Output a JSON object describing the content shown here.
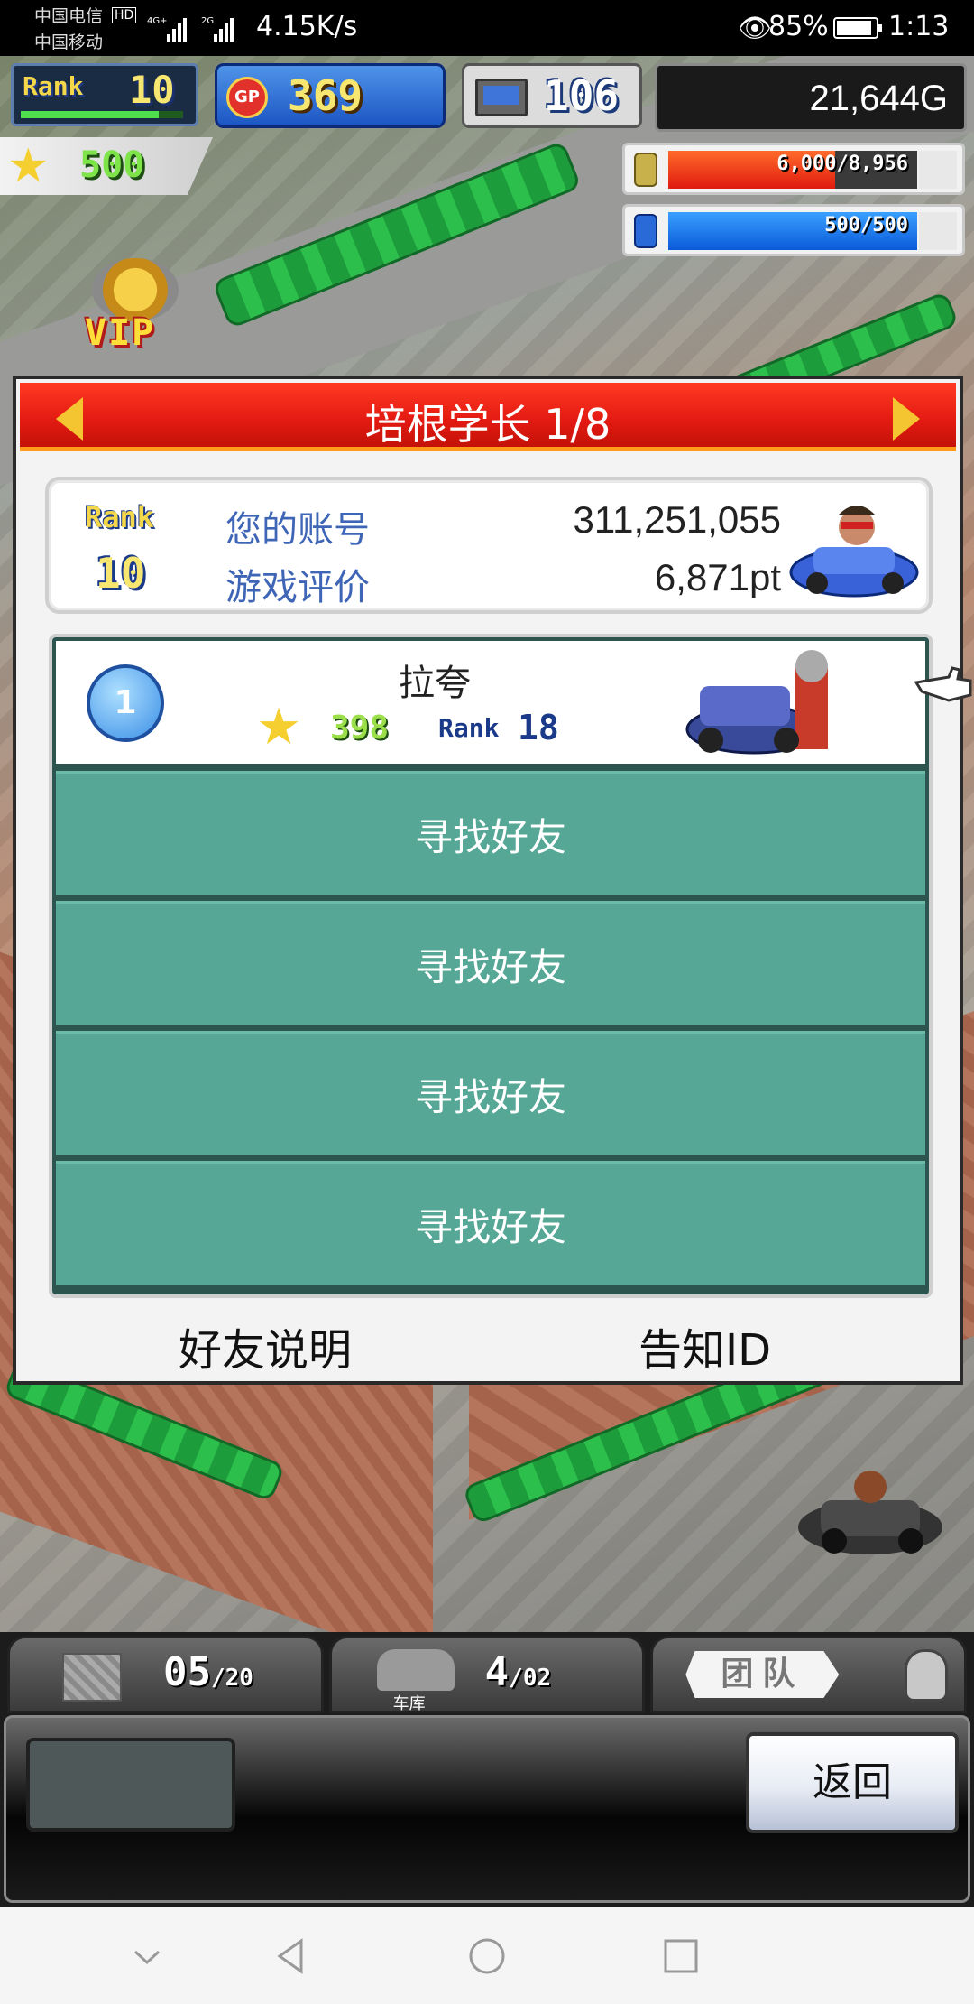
{
  "status_bar": {
    "carrier1": "中国电信",
    "carrier2": "中国移动",
    "hd_badge": "HD",
    "net_speed": "4.15K/s",
    "battery_pct": "85%",
    "time": "1:13"
  },
  "hud": {
    "rank_label": "Rank",
    "rank_value": "10",
    "gp_icon_text": "GP",
    "gp_value": "369",
    "pc_value": "106",
    "money": "21,644G",
    "stars": "500",
    "coins_gauge": "6,000/8,956",
    "coins_fraction": 0.67,
    "fuel_gauge": "500/500",
    "fuel_fraction": 1.0,
    "vip_label": "VIP"
  },
  "dialog": {
    "title": "培根学长 1/8",
    "account": {
      "rank_label": "Rank",
      "rank_value": "10",
      "id_label": "您的账号",
      "id_value": "311,251,055",
      "rating_label": "游戏评价",
      "rating_value": "6,871pt"
    },
    "friend": {
      "position": "1",
      "name": "拉夸",
      "stars": "398",
      "rank_label": "Rank",
      "rank_value": "18"
    },
    "find_buttons": [
      "寻找好友",
      "寻找好友",
      "寻找好友",
      "寻找好友"
    ],
    "footer": {
      "help": "好友说明",
      "share_id": "告知ID"
    }
  },
  "bottom_bar": {
    "slot1_num": "05",
    "slot1_den": "/20",
    "slot2_num": "4",
    "slot2_den": "/02",
    "garage_label": "车库",
    "team_label": "团队",
    "back": "返回"
  },
  "colors": {
    "header_red": "#e21a12",
    "find_teal": "#56a796",
    "label_blue": "#3f66b6"
  }
}
